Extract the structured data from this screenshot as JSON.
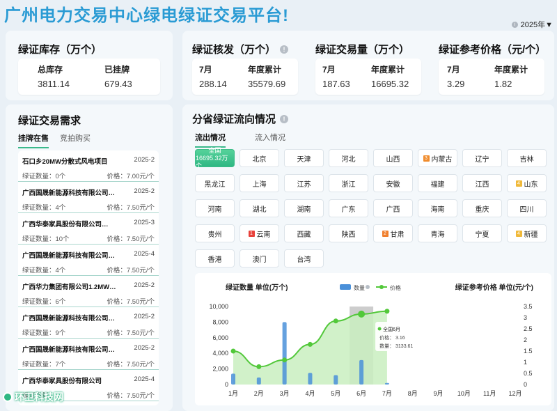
{
  "header": {
    "title": "广州电力交易中心绿电绿证交易平台!",
    "year": "2025年▼"
  },
  "inventory": {
    "title": "绿证库存（万个）",
    "total_label": "总库存",
    "total_value": "3811.14",
    "listed_label": "已挂牌",
    "listed_value": "679.43"
  },
  "issuance": {
    "title": "绿证核发（万个）",
    "month_label": "7月",
    "month_value": "288.14",
    "ytd_label": "年度累计",
    "ytd_value": "35579.69"
  },
  "volume": {
    "title": "绿证交易量（万个）",
    "month_label": "7月",
    "month_value": "187.63",
    "ytd_label": "年度累计",
    "ytd_value": "16695.32"
  },
  "price": {
    "title": "绿证参考价格（元/个）",
    "month_label": "7月",
    "month_value": "3.29",
    "ytd_label": "年度累计",
    "ytd_value": "1.82"
  },
  "demand": {
    "title": "绿证交易需求",
    "tabs": [
      "挂牌在售",
      "竞拍购买"
    ],
    "items": [
      {
        "name": "石口乡20MW分散式风电项目",
        "date": "2025-2",
        "qty": "绿证数量：0个",
        "price": "价格：7.00元/个"
      },
      {
        "name": "广西国晟新能源科技有限公司分…",
        "date": "2025-2",
        "qty": "绿证数量：4个",
        "price": "价格：7.50元/个"
      },
      {
        "name": "广西华泰家具股份有限公司…",
        "date": "2025-3",
        "qty": "绿证数量：10个",
        "price": "价格：7.50元/个"
      },
      {
        "name": "广西国晟新能源科技有限公司分…",
        "date": "2025-4",
        "qty": "绿证数量：4个",
        "price": "价格：7.50元/个"
      },
      {
        "name": "广西华力集团有限公司1.2MW…",
        "date": "2025-2",
        "qty": "绿证数量：6个",
        "price": "价格：7.50元/个"
      },
      {
        "name": "广西国晟新能源科技有限公司分…",
        "date": "2025-2",
        "qty": "绿证数量：9个",
        "price": "价格：7.50元/个"
      },
      {
        "name": "广西国晟新能源科技有限公司分…",
        "date": "2025-2",
        "qty": "绿证数量：7个",
        "price": "价格：7.50元/个"
      },
      {
        "name": "广西华泰家具股份有限公司",
        "date": "2025-4",
        "qty": "绿证数量：",
        "price": "价格：7.50元/个"
      }
    ]
  },
  "flow": {
    "title": "分省绿证流向情况",
    "tabs": [
      "流出情况",
      "流入情况"
    ],
    "provinces": [
      {
        "name": "全国",
        "sub": "16695.32万个",
        "selected": true
      },
      {
        "name": "北京"
      },
      {
        "name": "天津"
      },
      {
        "name": "河北"
      },
      {
        "name": "山西"
      },
      {
        "name": "内蒙古",
        "badge": "3",
        "badge_color": "#f08c2d"
      },
      {
        "name": "辽宁"
      },
      {
        "name": "吉林"
      },
      {
        "name": "黑龙江"
      },
      {
        "name": "上海"
      },
      {
        "name": "江苏"
      },
      {
        "name": "浙江"
      },
      {
        "name": "安徽"
      },
      {
        "name": "福建"
      },
      {
        "name": "江西"
      },
      {
        "name": "山东",
        "badge": "4",
        "badge_color": "#f0b93a"
      },
      {
        "name": "河南"
      },
      {
        "name": "湖北"
      },
      {
        "name": "湖南"
      },
      {
        "name": "广东"
      },
      {
        "name": "广西"
      },
      {
        "name": "海南"
      },
      {
        "name": "重庆"
      },
      {
        "name": "四川"
      },
      {
        "name": "贵州"
      },
      {
        "name": "云南",
        "badge": "1",
        "badge_color": "#e8423b"
      },
      {
        "name": "西藏"
      },
      {
        "name": "陕西"
      },
      {
        "name": "甘肃",
        "badge": "2",
        "badge_color": "#f07f2d"
      },
      {
        "name": "青海"
      },
      {
        "name": "宁夏"
      },
      {
        "name": "新疆",
        "badge": "4",
        "badge_color": "#f0b93a"
      },
      {
        "name": "香港"
      },
      {
        "name": "澳门"
      },
      {
        "name": "台湾"
      }
    ]
  },
  "chart_data": {
    "type": "bar",
    "categories": [
      "1月",
      "2月",
      "3月",
      "4月",
      "5月",
      "6月",
      "7月",
      "8月",
      "9月",
      "10月",
      "11月",
      "12月"
    ],
    "ylabel": "绿证数量 单位(万个)",
    "ylabel_right": "绿证参考价格 单位(元/个)",
    "legend": [
      "数量",
      "价格"
    ],
    "left_ticks": [
      "10,000",
      "8,000",
      "6,000",
      "4,000",
      "2,000",
      "0"
    ],
    "right_ticks": [
      "3.5",
      "3",
      "2.5",
      "2",
      "1.5",
      "1",
      "0.5",
      "0"
    ],
    "ylim": [
      0,
      10000
    ],
    "ylim_right": [
      0,
      3.5
    ],
    "series": [
      {
        "name": "数量",
        "values": [
          1400,
          900,
          8000,
          1500,
          1200,
          3133.61,
          200,
          0,
          0,
          0,
          0,
          0
        ]
      },
      {
        "name": "价格",
        "values": [
          1.5,
          0.8,
          1.1,
          1.8,
          2.85,
          3.16,
          3.29,
          null,
          null,
          null,
          null,
          null
        ]
      }
    ],
    "tooltip": {
      "title": "全国6月",
      "price_label": "价格：",
      "price_value": "3.16",
      "qty_label": "数量：",
      "qty_value": "3133.61"
    },
    "colors": {
      "bar": "#4a90d9",
      "line": "#52c83a",
      "area": "#c9efc0"
    }
  },
  "watermark": "环卫科技网"
}
